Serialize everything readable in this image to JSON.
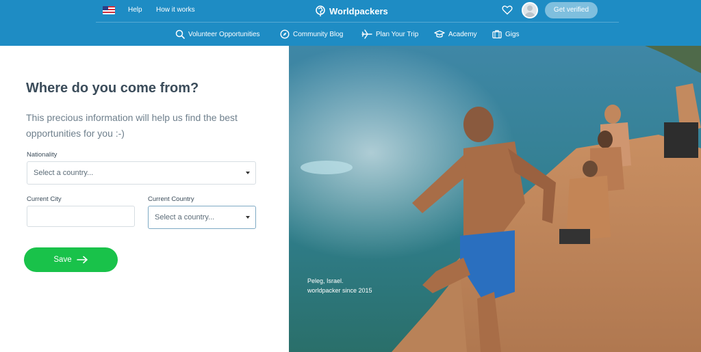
{
  "header": {
    "top_links": [
      "Help",
      "How it works"
    ],
    "brand": "Worldpackers",
    "verify_label": "Get verified",
    "nav": [
      {
        "label": "Volunteer Opportunities",
        "icon": "search-icon"
      },
      {
        "label": "Community Blog",
        "icon": "compass-icon"
      },
      {
        "label": "Plan Your Trip",
        "icon": "plane-icon"
      },
      {
        "label": "Academy",
        "icon": "graduation-cap-icon"
      },
      {
        "label": "Gigs",
        "icon": "briefcase-icon"
      }
    ]
  },
  "form": {
    "title": "Where do you come from?",
    "subtitle": "This precious information will help us find the best opportunities for you :-)",
    "nationality_label": "Nationality",
    "nationality_value": "Select a country...",
    "city_label": "Current City",
    "city_value": "",
    "country_label": "Current Country",
    "country_value": "Select a country...",
    "save_label": "Save"
  },
  "photo": {
    "credit_line1": "Peleg, Israel.",
    "credit_line2": "worldpacker since 2015"
  },
  "colors": {
    "header": "#1e8cc4",
    "save": "#19c24a",
    "title": "#3b4c5a",
    "subtitle": "#6e7f8c"
  }
}
